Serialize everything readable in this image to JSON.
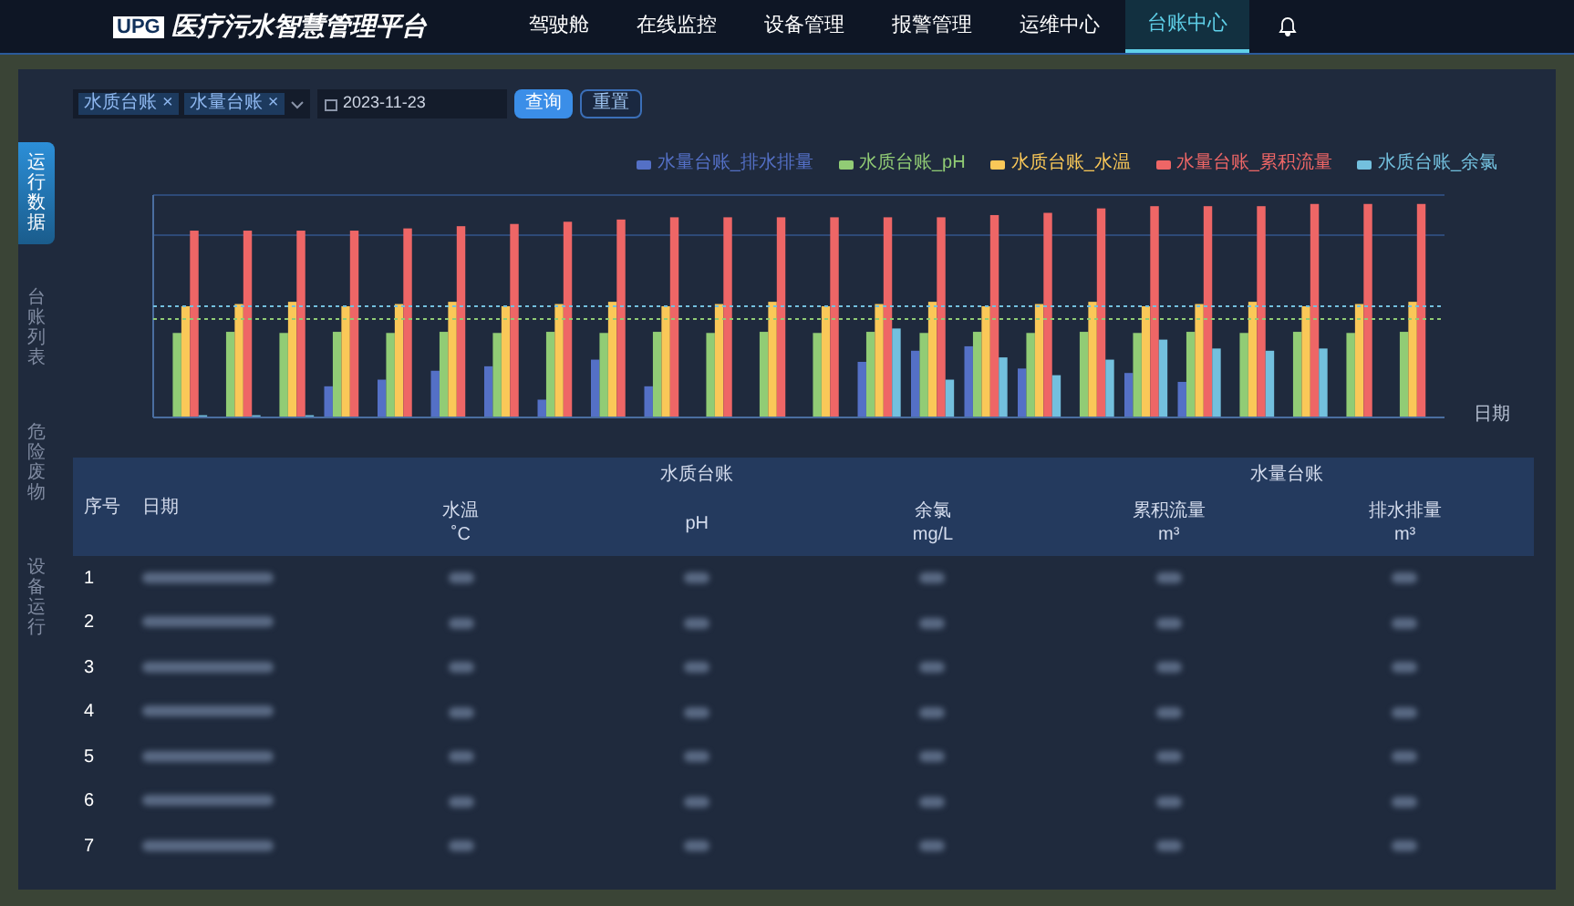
{
  "header": {
    "logo_text": "UPG",
    "title": "医疗污水智慧管理平台",
    "nav": [
      {
        "label": "驾驶舱",
        "selected": false
      },
      {
        "label": "在线监控",
        "selected": false
      },
      {
        "label": "设备管理",
        "selected": false
      },
      {
        "label": "报警管理",
        "selected": false
      },
      {
        "label": "运维中心",
        "selected": false
      },
      {
        "label": "台账中心",
        "selected": true
      }
    ]
  },
  "side_tabs": [
    {
      "label": "运行数据",
      "selected": true
    },
    {
      "label": "台账列表",
      "selected": false
    },
    {
      "label": "危险废物",
      "selected": false
    },
    {
      "label": "设备运行",
      "selected": false
    }
  ],
  "filter": {
    "tags": [
      {
        "label": "水质台账",
        "remove": "×"
      },
      {
        "label": "水量台账",
        "remove": "×"
      }
    ],
    "date": "2023-11-23",
    "buttons": [
      {
        "label": "查询",
        "kind": "primary"
      },
      {
        "label": "重置",
        "kind": "secondary"
      }
    ]
  },
  "chart": {
    "legend": [
      {
        "name": "水量台账_排水排量",
        "color": "#5470c6"
      },
      {
        "name": "水质台账_pH",
        "color": "#91cc75"
      },
      {
        "name": "水质台账_水温",
        "color": "#fac858"
      },
      {
        "name": "水量台账_累积流量",
        "color": "#ee6666"
      },
      {
        "name": "水质台账_余氯",
        "color": "#73c0de"
      }
    ],
    "x_axis_label": "日期"
  },
  "table": {
    "index_label": "序号",
    "date_label": "日期",
    "groups": [
      {
        "label": "水质台账",
        "columns": [
          {
            "label": "水温",
            "unit": "˚C"
          },
          {
            "label": "pH"
          },
          {
            "label": "余氯",
            "unit": "mg/L"
          }
        ]
      },
      {
        "label": "水量台账",
        "columns": [
          {
            "label": "累积流量",
            "unit": "m³"
          },
          {
            "label": "排水排量",
            "unit": "m³"
          }
        ]
      }
    ],
    "rows": [
      {
        "index": "1"
      },
      {
        "index": "2"
      },
      {
        "index": "3"
      },
      {
        "index": "4"
      },
      {
        "index": "5"
      },
      {
        "index": "6"
      },
      {
        "index": "7"
      }
    ]
  }
}
